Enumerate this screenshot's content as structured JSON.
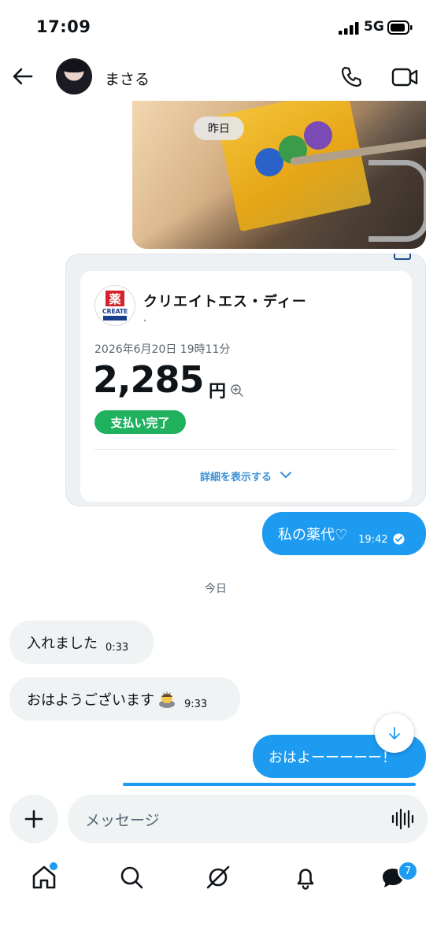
{
  "status_bar": {
    "time": "17:09",
    "network": "5G"
  },
  "header": {
    "name": "まさる",
    "icons": [
      "back-arrow-icon",
      "phone-icon",
      "video-call-icon"
    ]
  },
  "messages": {
    "photo_day_label": "昨日",
    "receipt": {
      "store": "クリエイトエス・ディー",
      "store_sub": "、",
      "logo_kanji": "薬",
      "logo_text": "CREATE",
      "datetime": "2026年6月20日 19時11分",
      "amount": "2,285",
      "currency": "円",
      "status": "支払い完了",
      "details_link": "詳細を表示する"
    },
    "sent_1": {
      "text": "私の薬代♡",
      "time": "19:42"
    },
    "today_label": "今日",
    "received_1": {
      "text": "入れました",
      "time": "0:33"
    },
    "received_2": {
      "text": "おはようございます",
      "time": "9:33"
    },
    "sent_2": {
      "text": "おはよーーーーー！"
    }
  },
  "composer": {
    "placeholder": "メッセージ"
  },
  "tabs": {
    "messages_badge": "7"
  },
  "colors": {
    "accent": "#1d9bf0",
    "paid": "#20b15f",
    "bubble_in": "#eff3f4"
  }
}
